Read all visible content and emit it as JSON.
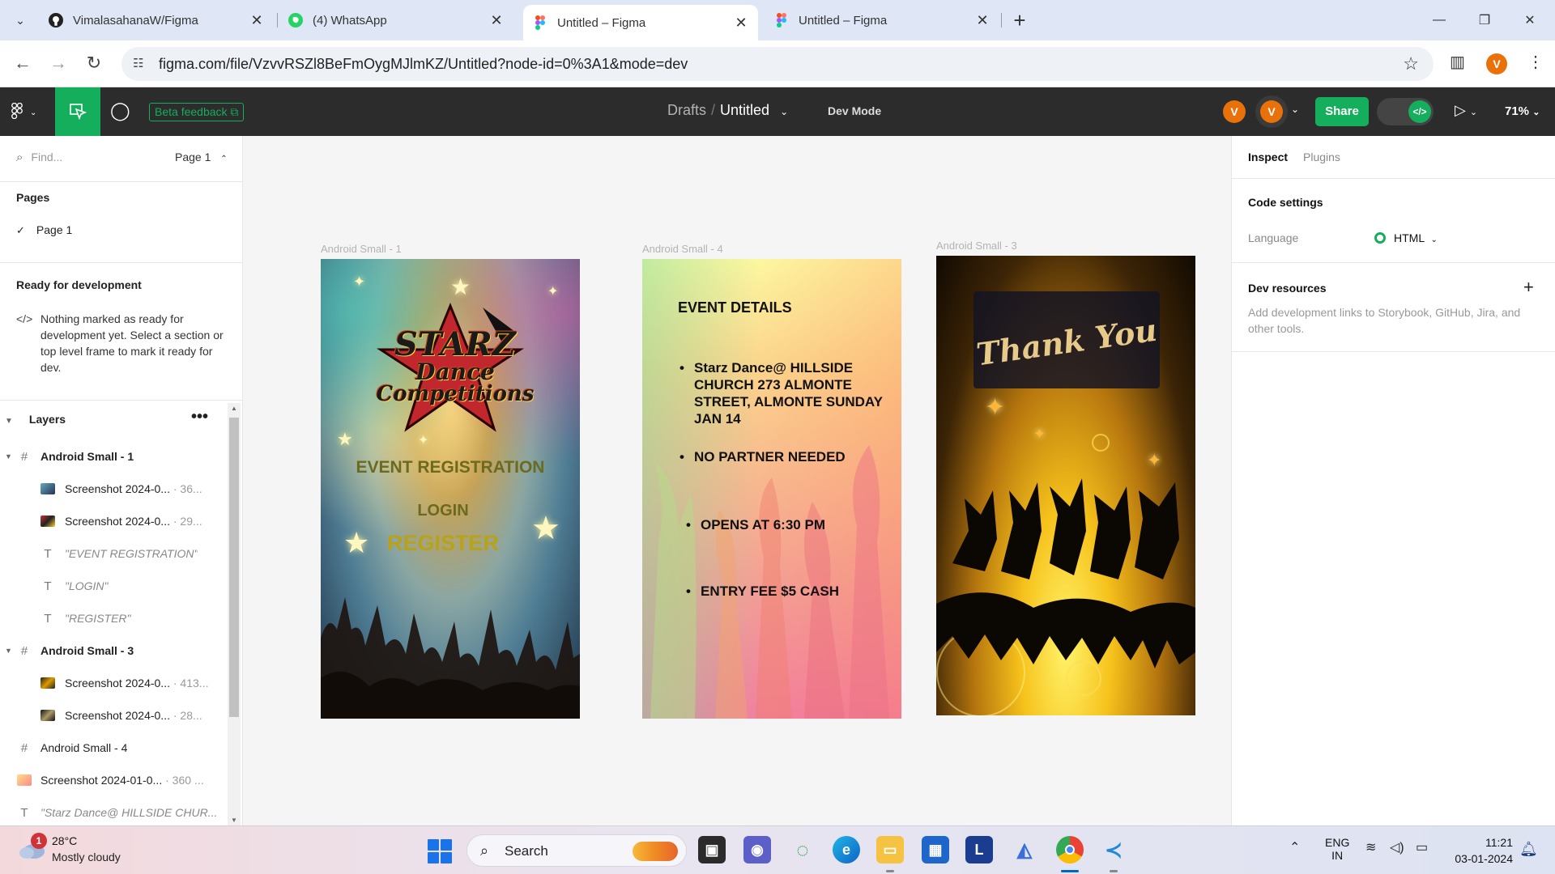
{
  "browser": {
    "tabs": [
      {
        "title": "VimalasahanaW/Figma",
        "icon": "github-icon"
      },
      {
        "title": "(4) WhatsApp",
        "icon": "whatsapp-icon"
      },
      {
        "title": "Untitled – Figma",
        "icon": "figma-icon",
        "active": true
      },
      {
        "title": "Untitled – Figma",
        "icon": "figma-icon"
      }
    ],
    "url": "figma.com/file/VzvvRSZl8BeFmOygMJlmKZ/Untitled?node-id=0%3A1&mode=dev",
    "profile_initial": "V"
  },
  "figma_toolbar": {
    "beta_feedback": "Beta feedback",
    "breadcrumb_parent": "Drafts",
    "breadcrumb_current": "Untitled",
    "dev_mode": "Dev Mode",
    "avatar_initial": "V",
    "share_label": "Share",
    "zoom": "71%"
  },
  "left_panel": {
    "find_placeholder": "Find...",
    "page_selector": "Page 1",
    "pages_title": "Pages",
    "pages": [
      "Page 1"
    ],
    "ready_title": "Ready for development",
    "ready_text": "Nothing marked as ready for development yet. Select a section or top level frame to mark it ready for dev.",
    "layers_title": "Layers",
    "layers": [
      {
        "name": "Android Small - 1",
        "meta": "",
        "kind": "frame"
      },
      {
        "name": "Screenshot 2024-0...",
        "meta": "· 36...",
        "kind": "image"
      },
      {
        "name": "Screenshot 2024-0...",
        "meta": "· 29...",
        "kind": "image"
      },
      {
        "name": "\"EVENT REGISTRATION\"",
        "meta": "",
        "kind": "text"
      },
      {
        "name": "\"LOGIN\"",
        "meta": "",
        "kind": "text"
      },
      {
        "name": "\"REGISTER\"",
        "meta": "",
        "kind": "text"
      },
      {
        "name": "Android Small - 3",
        "meta": "",
        "kind": "frame"
      },
      {
        "name": "Screenshot 2024-0...",
        "meta": "· 413...",
        "kind": "image"
      },
      {
        "name": "Screenshot 2024-0...",
        "meta": "· 28...",
        "kind": "image"
      },
      {
        "name": "Android Small - 4",
        "meta": "",
        "kind": "frame-collapsed"
      },
      {
        "name": "Screenshot 2024-01-0...",
        "meta": "· 360 ...",
        "kind": "image-root"
      },
      {
        "name": "\"Starz Dance@ HILLSIDE CHUR...",
        "meta": "",
        "kind": "text-root"
      }
    ]
  },
  "canvas": {
    "frame1": {
      "label": "Android Small - 1",
      "logo_line1": "STARZ",
      "logo_line2": "Dance",
      "logo_line3": "Competitions",
      "event_registration": "EVENT REGISTRATION",
      "login": "LOGIN",
      "register": "REGISTER"
    },
    "frame2": {
      "label": "Android Small - 4",
      "title": "EVENT DETAILS",
      "items": [
        "Starz Dance@ HILLSIDE CHURCH 273 ALMONTE STREET, ALMONTE SUNDAY JAN 14",
        "NO PARTNER  NEEDED",
        "OPENS AT 6:30 PM",
        "ENTRY FEE $5 CASH"
      ]
    },
    "frame3": {
      "label": "Android Small - 3",
      "thank_you": "Thank You"
    }
  },
  "right_panel": {
    "tab_inspect": "Inspect",
    "tab_plugins": "Plugins",
    "code_settings": "Code settings",
    "language_label": "Language",
    "language_value": "HTML",
    "dev_resources": "Dev resources",
    "dev_resources_desc": "Add development links to Storybook, GitHub, Jira, and other tools."
  },
  "taskbar": {
    "weather_badge": "1",
    "temperature": "28°C",
    "weather": "Mostly cloudy",
    "search": "Search",
    "lang_line1": "ENG",
    "lang_line2": "IN",
    "time": "11:21",
    "date": "03-01-2024",
    "letter_app": "L"
  }
}
